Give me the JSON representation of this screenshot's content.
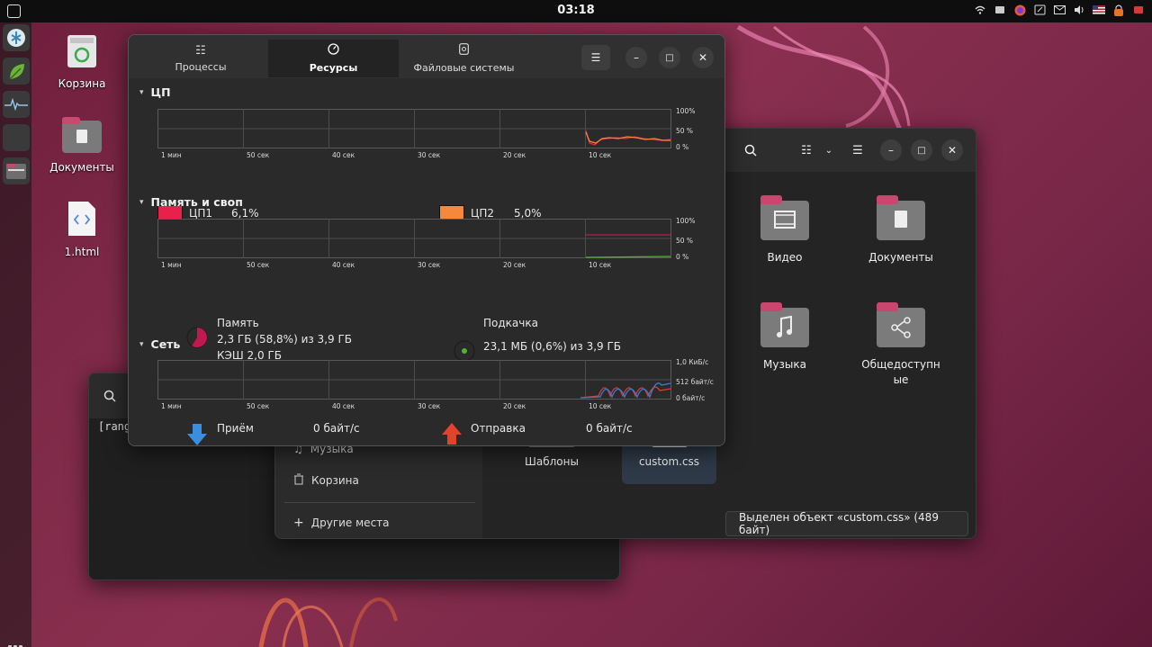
{
  "topbar": {
    "clock": "03:18",
    "tray_icons": [
      "wifi-icon",
      "network-icon",
      "firefox-icon",
      "screen-icon",
      "mail-icon",
      "volume-icon",
      "language-flag-icon",
      "lock-icon",
      "mail-notify-icon"
    ]
  },
  "desktop": {
    "icons": [
      {
        "label": "Корзина"
      },
      {
        "label": "Документы"
      },
      {
        "label": "1.html"
      }
    ]
  },
  "files": {
    "sidebar": {
      "items": [
        {
          "label": "Музыка"
        },
        {
          "label": "Корзина"
        },
        {
          "label": "Другие места"
        }
      ]
    },
    "folders": [
      {
        "label": "Видео"
      },
      {
        "label": "Документы"
      },
      {
        "label": "Музыка"
      },
      {
        "label": "Общедоступные"
      },
      {
        "label": "Шаблоны"
      },
      {
        "label": "custom.css"
      }
    ],
    "status": "Выделен объект «custom.css» (489 байт)"
  },
  "terminal": {
    "partial_text": "[rang"
  },
  "sysmon": {
    "tabs": [
      {
        "label": "Процессы",
        "icon": "list-icon",
        "active": false
      },
      {
        "label": "Ресурсы",
        "icon": "gauge-icon",
        "active": true
      },
      {
        "label": "Файловые системы",
        "icon": "disk-icon",
        "active": false
      }
    ],
    "cpu": {
      "title": "ЦП",
      "x_ticks": [
        "1 мин",
        "50 сек",
        "40 сек",
        "30 сек",
        "20 сек",
        "10 сек"
      ],
      "y_ticks": [
        "100%",
        "50 %",
        "0 %"
      ],
      "legend": [
        {
          "name": "ЦП1",
          "value": "6,1%",
          "color": "#e8214a"
        },
        {
          "name": "ЦП2",
          "value": "5,0%",
          "color": "#f5893b"
        }
      ]
    },
    "memory": {
      "title": "Память и своп",
      "x_ticks": [
        "1 мин",
        "50 сек",
        "40 сек",
        "30 сек",
        "20 сек",
        "10 сек"
      ],
      "y_ticks": [
        "100%",
        "50 %",
        "0 %"
      ],
      "mem_label": "Память",
      "mem_value": "2,3 ГБ (58,8%) из 3,9 ГБ",
      "cache": "КЭШ 2,0 ГБ",
      "swap_label": "Подкачка",
      "swap_value": "23,1 МБ (0,6%) из 3,9 ГБ",
      "mem_color": "#c0184f",
      "swap_color": "#4eb52d"
    },
    "network": {
      "title": "Сеть",
      "x_ticks": [
        "1 мин",
        "50 сек",
        "40 сек",
        "30 сек",
        "20 сек",
        "10 сек"
      ],
      "y_ticks": [
        "1,0 КиБ/с",
        "512 байт/с",
        "0 байт/с"
      ],
      "recv_label": "Приём",
      "recv_value": "0 байт/с",
      "send_label": "Отправка",
      "send_value": "0 байт/с",
      "recv_color": "#3a7ad8",
      "send_color": "#e03a2a"
    }
  }
}
